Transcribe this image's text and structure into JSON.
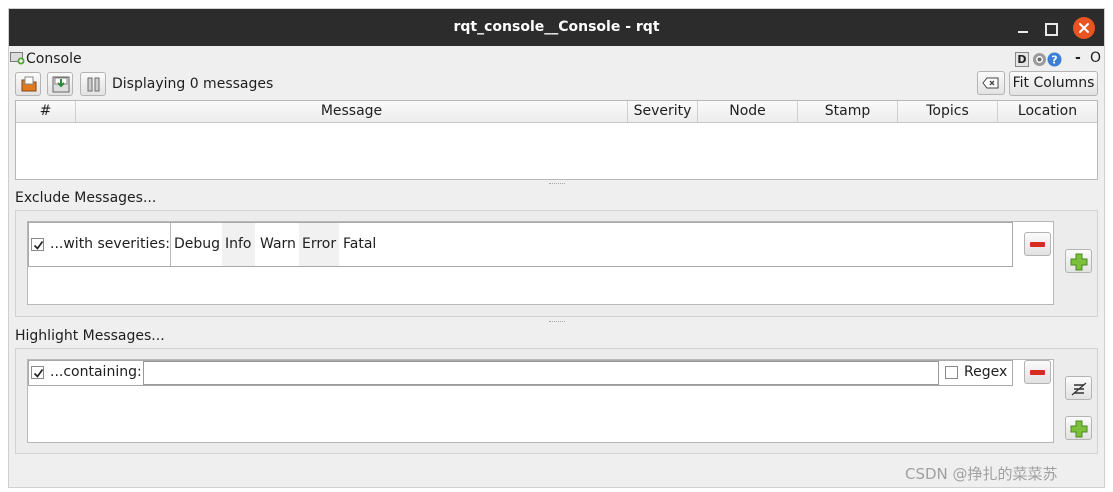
{
  "window": {
    "title": "rqt_console__Console - rqt",
    "controls": [
      "minimize-icon",
      "maximize-icon",
      "close-icon"
    ],
    "close_color": "#e95420"
  },
  "plugin": {
    "title": "Console",
    "icons": [
      "D",
      "gear-icon",
      "help-icon"
    ],
    "dash": "-",
    "o": "O"
  },
  "toolbar": {
    "icons": [
      "load-icon",
      "save-icon",
      "pause-icon"
    ],
    "status": "Displaying 0 messages",
    "clear_icon": "clear-icon",
    "fit_columns_label": "Fit Columns"
  },
  "table": {
    "columns": [
      "#",
      "Message",
      "Severity",
      "Node",
      "Stamp",
      "Topics",
      "Location"
    ],
    "rows": []
  },
  "exclude": {
    "title": "Exclude Messages...",
    "label": "...with severities:",
    "checked": true,
    "severities": [
      "Debug",
      "Info",
      "Warn",
      "Error",
      "Fatal"
    ]
  },
  "highlight": {
    "title": "Highlight Messages...",
    "label": "...containing:",
    "checked": true,
    "value": "",
    "regex_label": "Regex",
    "regex_checked": false
  },
  "watermark": "CSDN @挣扎的菜菜苏"
}
